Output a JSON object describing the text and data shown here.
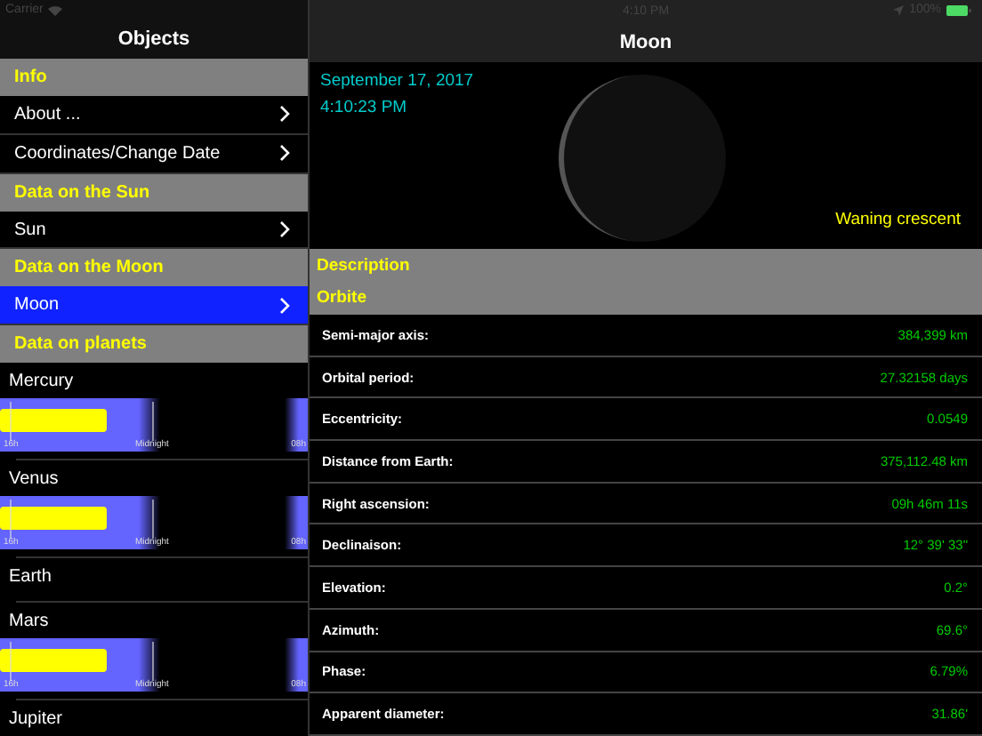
{
  "status_bar": {
    "carrier": "Carrier",
    "time": "4:10 PM",
    "battery": "100%"
  },
  "master": {
    "title": "Objects",
    "items": [
      {
        "kind": "header",
        "label": "Info"
      },
      {
        "kind": "link",
        "label": "About ...",
        "selected": false
      },
      {
        "kind": "link",
        "label": "Coordinates/Change Date",
        "selected": false
      },
      {
        "kind": "header",
        "label": "Data on the Sun"
      },
      {
        "kind": "link",
        "label": "Sun",
        "selected": false
      },
      {
        "kind": "header",
        "label": "Data on the Moon"
      },
      {
        "kind": "link",
        "label": "Moon",
        "selected": true
      },
      {
        "kind": "header",
        "label": "Data on planets"
      },
      {
        "kind": "planet",
        "label": "Mercury",
        "axis_labels": [
          "16h",
          "Midnight",
          "08h"
        ]
      },
      {
        "kind": "planet",
        "label": "Venus",
        "axis_labels": [
          "16h",
          "Midnight",
          "08h"
        ]
      },
      {
        "kind": "planet",
        "label": "Earth"
      },
      {
        "kind": "planet",
        "label": "Mars",
        "axis_labels": [
          "16h",
          "Midnight",
          "08h"
        ]
      },
      {
        "kind": "planet",
        "label": "Jupiter"
      }
    ]
  },
  "detail": {
    "title": "Moon",
    "date": "September 17, 2017",
    "time": "4:10:23 PM",
    "phase_name": "Waning crescent",
    "sections": [
      {
        "title": "Description"
      },
      {
        "title": "Orbite"
      }
    ],
    "rows": [
      {
        "label": "Semi-major axis:",
        "value": "384,399 km"
      },
      {
        "label": "Orbital period:",
        "value": "27.32158 days"
      },
      {
        "label": "Eccentricity:",
        "value": "0.0549"
      },
      {
        "label": "Distance from Earth:",
        "value": "375,112.48 km"
      },
      {
        "label": "Right ascension:",
        "value": "09h 46m 11s"
      },
      {
        "label": "Declinaison:",
        "value": "12° 39' 33\""
      },
      {
        "label": "Elevation:",
        "value": "0.2°"
      },
      {
        "label": "Azimuth:",
        "value": "69.6°"
      },
      {
        "label": "Phase:",
        "value": "6.79%"
      },
      {
        "label": "Apparent diameter:",
        "value": "31.86'"
      }
    ]
  }
}
